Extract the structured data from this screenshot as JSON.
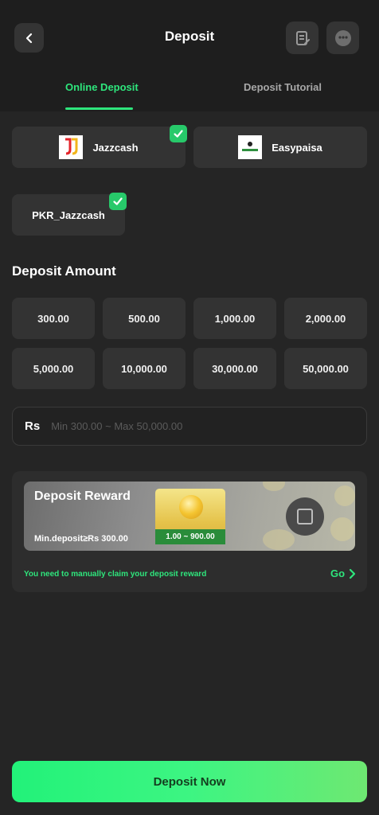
{
  "header": {
    "title": "Deposit",
    "back_icon": "chevron-left-icon",
    "records_icon": "document-edit-icon",
    "support_icon": "chat-bubble-icon"
  },
  "tabs": [
    {
      "label": "Online Deposit",
      "active": true
    },
    {
      "label": "Deposit Tutorial",
      "active": false
    }
  ],
  "methods": [
    {
      "label": "Jazzcash",
      "logo_text": "JazzCash",
      "selected": true
    },
    {
      "label": "Easypaisa",
      "logo_text": "easypaisa",
      "selected": false
    }
  ],
  "channel": {
    "label": "PKR_Jazzcash",
    "selected": true
  },
  "amount_section": {
    "title": "Deposit Amount"
  },
  "amounts": [
    "300.00",
    "500.00",
    "1,000.00",
    "2,000.00",
    "5,000.00",
    "10,000.00",
    "30,000.00",
    "50,000.00"
  ],
  "amount_input": {
    "currency": "Rs",
    "value": "",
    "placeholder": "Min 300.00 ~ Max 50,000.00"
  },
  "reward": {
    "title": "Deposit Reward",
    "min_deposit": "Min.deposit≥Rs 300.00",
    "range": "1.00 ~ 900.00",
    "note": "You need to manually claim your deposit reward",
    "go_label": "Go"
  },
  "submit": {
    "label": "Deposit Now"
  },
  "colors": {
    "accent": "#2ee57c",
    "background": "#252525",
    "card": "#333333",
    "check": "#27c96a"
  }
}
